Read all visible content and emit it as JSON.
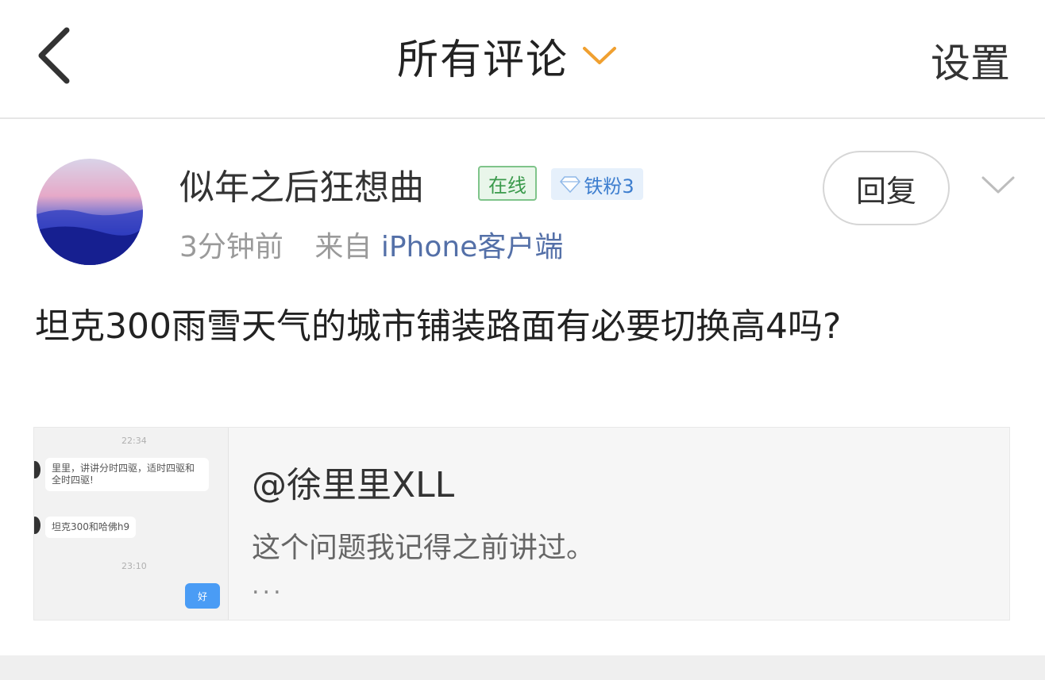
{
  "header": {
    "title": "所有评论",
    "settings_label": "设置"
  },
  "comment": {
    "username": "似年之后狂想曲",
    "badge_online": "在线",
    "badge_fan": "铁粉3",
    "time": "3分钟前",
    "source_prefix": "来自",
    "source_client": "iPhone客户端",
    "reply_label": "回复",
    "text": "坦克300雨雪天气的城市铺装路面有必要切换高4吗?"
  },
  "quote": {
    "title": "@徐里里XLL",
    "text": "这个问题我记得之前讲过。",
    "more": "...",
    "thumbnail": {
      "time1": "22:34",
      "msg1": "里里，讲讲分时四驱，适时四驱和全时四驱!",
      "msg2": "坦克300和哈佛h9",
      "time2": "23:10",
      "reply": "好"
    }
  },
  "colors": {
    "accent_orange": "#f0a030",
    "link_blue": "#5470a8",
    "online_green": "#3a9a4b",
    "fan_blue": "#3d7ecf"
  },
  "icons": [
    "back-arrow-icon",
    "chevron-down-icon",
    "avatar",
    "diamond-icon",
    "expand-chevron-icon"
  ]
}
